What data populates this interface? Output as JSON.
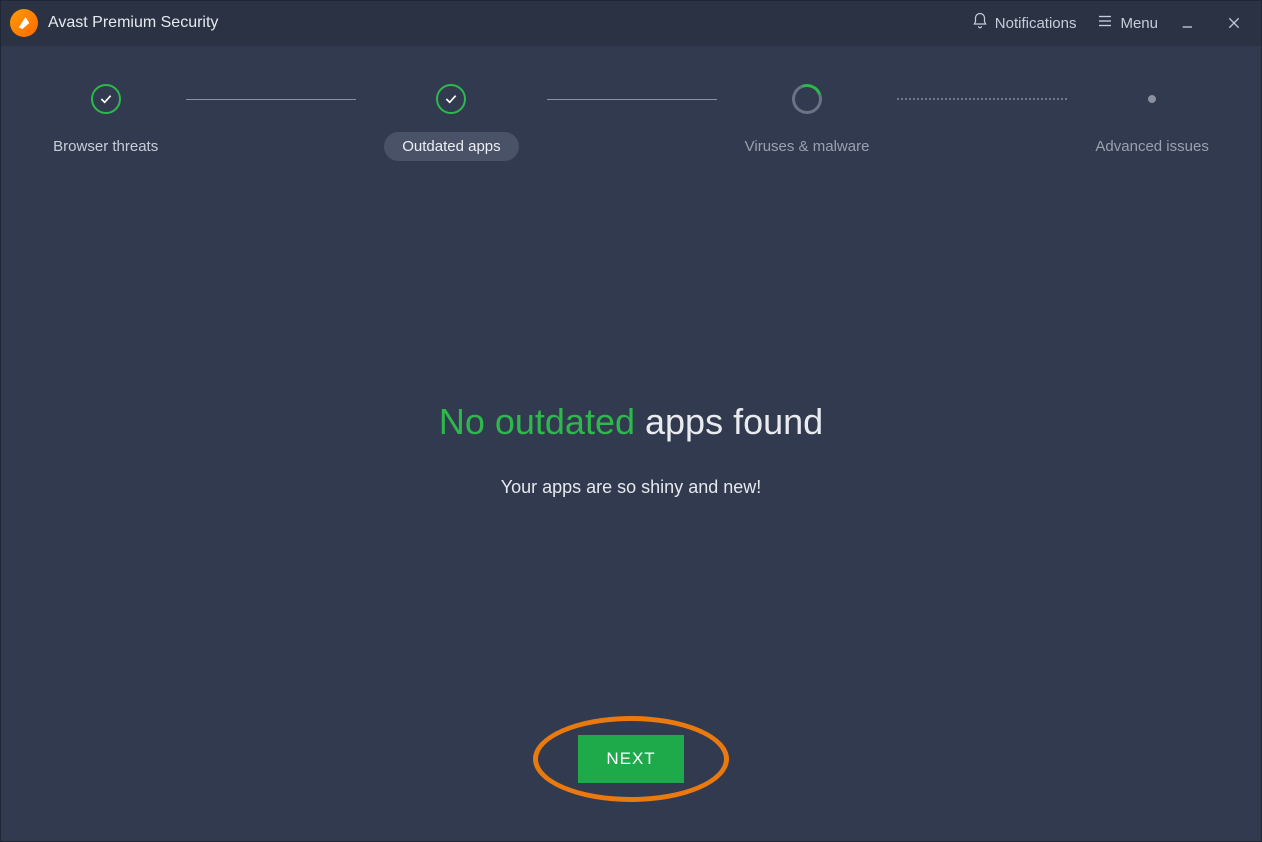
{
  "titlebar": {
    "app_title": "Avast Premium Security",
    "notifications_label": "Notifications",
    "menu_label": "Menu"
  },
  "stepper": {
    "steps": [
      {
        "label": "Browser threats"
      },
      {
        "label": "Outdated apps"
      },
      {
        "label": "Viruses & malware"
      },
      {
        "label": "Advanced issues"
      }
    ]
  },
  "result": {
    "headline_green": "No outdated",
    "headline_rest": " apps found",
    "subline": "Your apps are so shiny and new!"
  },
  "actions": {
    "next_label": "NEXT"
  },
  "colors": {
    "accent_green": "#2DB84C",
    "button_green": "#1EA94A",
    "highlight_orange": "#EA7A0E",
    "bg": "#323A4F",
    "titlebar_bg": "#2A3244"
  }
}
